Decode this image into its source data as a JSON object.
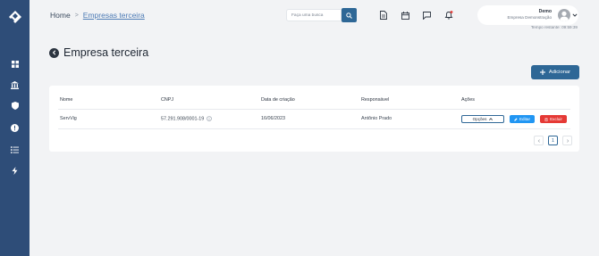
{
  "sidebar": {
    "logo": "diamond-logo",
    "items": [
      {
        "icon": "grid-icon"
      },
      {
        "icon": "bank-icon"
      },
      {
        "icon": "shield-icon"
      },
      {
        "icon": "alert-icon"
      },
      {
        "icon": "list-icon"
      },
      {
        "icon": "bolt-icon"
      }
    ]
  },
  "breadcrumb": {
    "home": "Home",
    "separator": ">",
    "current": "Empresas terceira"
  },
  "search": {
    "placeholder": "Faça uma busca"
  },
  "header_icons": [
    "document-icon",
    "calendar-icon",
    "chat-icon",
    "bell-icon"
  ],
  "user": {
    "name": "Demo",
    "company": "Empresa Demonstração",
    "time_remaining": "Tempo restante: 09:59:39"
  },
  "page": {
    "title": "Empresa terceira",
    "add_label": "Adicionar"
  },
  "table": {
    "columns": [
      "Nome",
      "CNPJ",
      "Data de criação",
      "Responsável",
      "Ações"
    ],
    "rows": [
      {
        "nome": "ServVig",
        "cnpj": "57.291.908/0001-19",
        "data": "16/06/2023",
        "responsavel": "Antônio Prado"
      }
    ],
    "actions": {
      "opcoes": "Opções",
      "editar": "Editar",
      "excluir": "Excluir"
    }
  },
  "pagination": {
    "current_page": "1"
  },
  "colors": {
    "sidebar": "#2e4d78",
    "primary": "#2e6796",
    "edit": "#2196f3",
    "delete": "#e53935"
  }
}
